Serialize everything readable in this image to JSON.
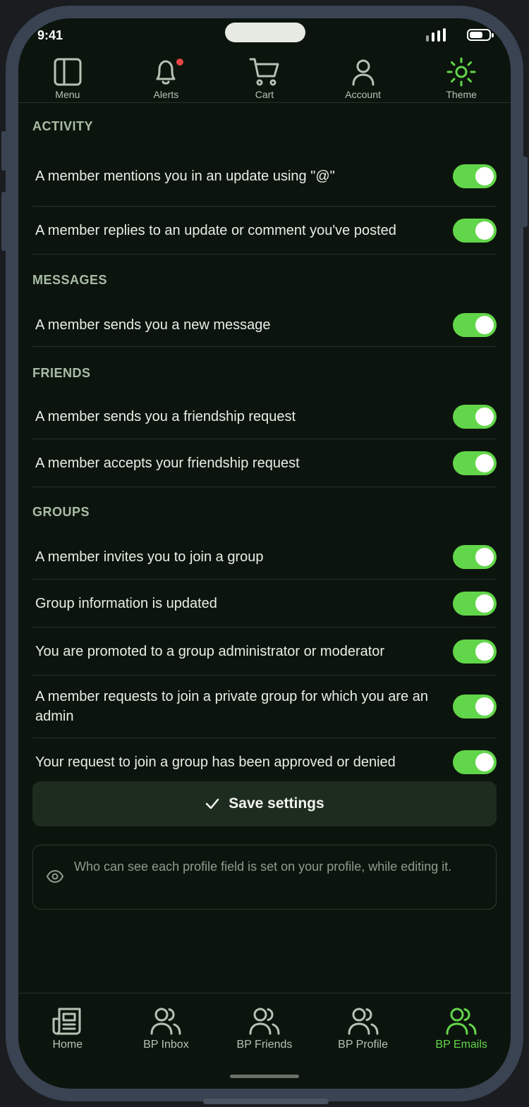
{
  "status_bar": {
    "time": "9:41"
  },
  "top_nav": {
    "items": [
      {
        "label": "Menu",
        "icon": "sidebar-panel-icon"
      },
      {
        "label": "Alerts",
        "icon": "bell-icon",
        "has_badge": true
      },
      {
        "label": "Cart",
        "icon": "cart-icon"
      },
      {
        "label": "Account",
        "icon": "user-icon"
      },
      {
        "label": "Theme",
        "icon": "sun-icon",
        "active": true
      }
    ]
  },
  "sections": [
    {
      "title": "ACTIVITY",
      "items": [
        {
          "text": "A member mentions you in an update using \"@\"",
          "enabled": true
        },
        {
          "text": "A member replies to an update or comment you've posted",
          "enabled": true
        }
      ]
    },
    {
      "title": "MESSAGES",
      "items": [
        {
          "text": "A member sends you a new message",
          "enabled": true
        }
      ]
    },
    {
      "title": "FRIENDS",
      "items": [
        {
          "text": "A member sends you a friendship request",
          "enabled": true
        },
        {
          "text": "A member accepts your friendship request",
          "enabled": true
        }
      ]
    },
    {
      "title": "GROUPS",
      "items": [
        {
          "text": "A member invites you to join a group",
          "enabled": true
        },
        {
          "text": "Group information is updated",
          "enabled": true
        },
        {
          "text": "You are promoted to a group administrator or moderator",
          "enabled": true
        },
        {
          "text": "A member requests to join a private group for which you are an admin",
          "enabled": true
        },
        {
          "text": "Your request to join a group has been approved or denied",
          "enabled": true
        }
      ]
    }
  ],
  "save_button": {
    "label": "Save settings",
    "icon": "check-icon"
  },
  "info_box": {
    "icon": "eye-icon",
    "text": "Who can see each profile field is set on your profile, while editing it."
  },
  "tab_bar": {
    "items": [
      {
        "label": "Home",
        "icon": "newspaper-icon"
      },
      {
        "label": "BP Inbox",
        "icon": "users-icon"
      },
      {
        "label": "BP Friends",
        "icon": "users-icon"
      },
      {
        "label": "BP Profile",
        "icon": "users-icon"
      },
      {
        "label": "BP Emails",
        "icon": "users-icon",
        "active": true
      }
    ]
  },
  "colors": {
    "accent": "#62d64a",
    "background": "#0c150d",
    "section_title": "#a9bda7",
    "badge": "#e24545"
  }
}
